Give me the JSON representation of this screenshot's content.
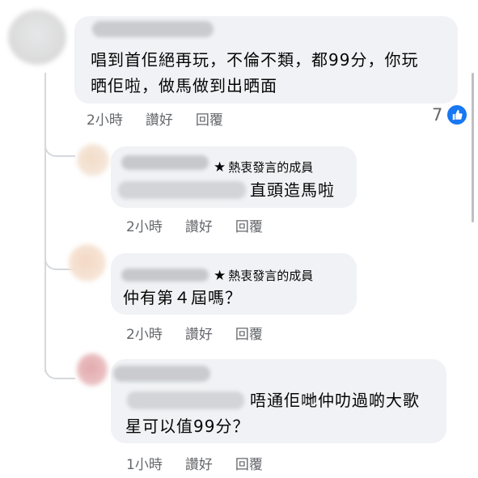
{
  "comments": [
    {
      "text_lines": [
        "唱到首佢絕再玩，不倫不類，都99分，你玩",
        "晒佢啦，做馬做到出晒面"
      ],
      "time": "2小時",
      "like": "讚好",
      "reply": "回覆",
      "reaction_count": "7",
      "reaction_icon": "like-icon"
    },
    {
      "badge": "熱衷發言的成員",
      "text_lines": [
        "直頭造馬啦"
      ],
      "time": "2小時",
      "like": "讚好",
      "reply": "回覆"
    },
    {
      "badge": "熱衷發言的成員",
      "text_lines": [
        "仲有第４屆嗎？"
      ],
      "time": "2小時",
      "like": "讚好",
      "reply": "回覆"
    },
    {
      "text_lines": [
        "唔通佢哋仲叻過啲大歌",
        "星可以值99分？"
      ],
      "time": "1小時",
      "like": "讚好",
      "reply": "回覆"
    }
  ],
  "colors": {
    "bubble": "#f0f2f5",
    "meta_text": "#65676b",
    "like_blue": "#1877f2"
  }
}
